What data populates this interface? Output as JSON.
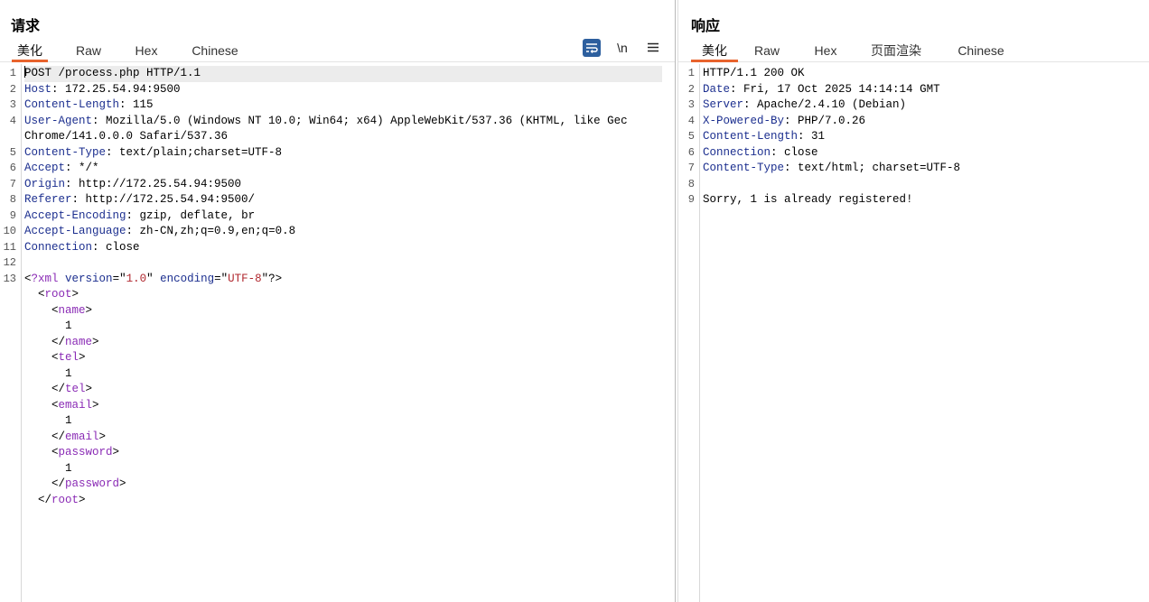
{
  "request": {
    "title": "请求",
    "tabs": [
      "美化",
      "Raw",
      "Hex",
      "Chinese"
    ],
    "toolbar": {
      "newline_label": "\\n"
    },
    "lines": [
      {
        "n": "1",
        "h": "",
        "v": "POST /process.php HTTP/1.1"
      },
      {
        "n": "2",
        "h": "Host",
        "v": "172.25.54.94:9500"
      },
      {
        "n": "3",
        "h": "Content-Length",
        "v": "115"
      },
      {
        "n": "4",
        "h": "User-Agent",
        "v": "Mozilla/5.0 (Windows NT 10.0; Win64; x64) AppleWebKit/537.36 (KHTML, like Gec"
      },
      {
        "n": "",
        "h": "",
        "v": "Chrome/141.0.0.0 Safari/537.36"
      },
      {
        "n": "5",
        "h": "Content-Type",
        "v": "text/plain;charset=UTF-8"
      },
      {
        "n": "6",
        "h": "Accept",
        "v": "*/*"
      },
      {
        "n": "7",
        "h": "Origin",
        "v": "http://172.25.54.94:9500"
      },
      {
        "n": "8",
        "h": "Referer",
        "v": "http://172.25.54.94:9500/"
      },
      {
        "n": "9",
        "h": "Accept-Encoding",
        "v": "gzip, deflate, br"
      },
      {
        "n": "10",
        "h": "Accept-Language",
        "v": "zh-CN,zh;q=0.9,en;q=0.8"
      },
      {
        "n": "11",
        "h": "Connection",
        "v": "close"
      },
      {
        "n": "12",
        "h": "",
        "v": ""
      }
    ],
    "xml_decl": {
      "n": "13",
      "version": "1.0",
      "encoding": "UTF-8"
    },
    "xml": [
      {
        "indent": 1,
        "kind": "open",
        "tag": "root"
      },
      {
        "indent": 2,
        "kind": "open",
        "tag": "name"
      },
      {
        "indent": 3,
        "kind": "text",
        "text": "1"
      },
      {
        "indent": 2,
        "kind": "close",
        "tag": "name"
      },
      {
        "indent": 2,
        "kind": "open",
        "tag": "tel"
      },
      {
        "indent": 3,
        "kind": "text",
        "text": "1"
      },
      {
        "indent": 2,
        "kind": "close",
        "tag": "tel"
      },
      {
        "indent": 2,
        "kind": "open",
        "tag": "email"
      },
      {
        "indent": 3,
        "kind": "text",
        "text": "1"
      },
      {
        "indent": 2,
        "kind": "close",
        "tag": "email"
      },
      {
        "indent": 2,
        "kind": "open",
        "tag": "password"
      },
      {
        "indent": 3,
        "kind": "text",
        "text": "1"
      },
      {
        "indent": 2,
        "kind": "close",
        "tag": "password"
      },
      {
        "indent": 1,
        "kind": "close",
        "tag": "root"
      }
    ]
  },
  "response": {
    "title": "响应",
    "tabs": [
      "美化",
      "Raw",
      "Hex",
      "页面渲染",
      "Chinese"
    ],
    "lines": [
      {
        "n": "1",
        "h": "",
        "v": "HTTP/1.1 200 OK"
      },
      {
        "n": "2",
        "h": "Date",
        "v": "Fri, 17 Oct 2025 14:14:14 GMT"
      },
      {
        "n": "3",
        "h": "Server",
        "v": "Apache/2.4.10 (Debian)"
      },
      {
        "n": "4",
        "h": "X-Powered-By",
        "v": "PHP/7.0.26"
      },
      {
        "n": "5",
        "h": "Content-Length",
        "v": "31"
      },
      {
        "n": "6",
        "h": "Connection",
        "v": "close"
      },
      {
        "n": "7",
        "h": "Content-Type",
        "v": "text/html; charset=UTF-8"
      },
      {
        "n": "8",
        "h": "",
        "v": ""
      },
      {
        "n": "9",
        "h": "",
        "v": "Sorry, 1 is already registered!"
      }
    ]
  },
  "colors": {
    "accent": "#e8632d",
    "header_key": "#1c2f8f",
    "xml_tag": "#8a2bb5",
    "attr_value": "#b0272e",
    "wrap_button": "#2d5f9e"
  },
  "icons": {
    "wrap": "text-wrap-icon",
    "menu": "hamburger-menu-icon"
  }
}
